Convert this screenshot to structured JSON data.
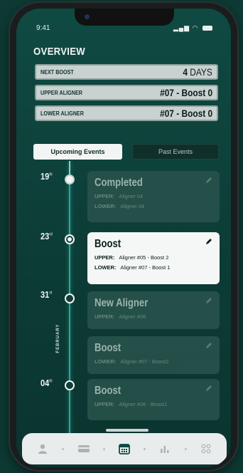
{
  "status": {
    "time": "9:41"
  },
  "overview": {
    "title": "OVERVIEW",
    "next_boost": {
      "label": "NEXT BOOST",
      "number": "4",
      "unit": "DAYS"
    },
    "upper_aligner": {
      "label": "UPPER ALIGNER",
      "value": "#07 - Boost 0"
    },
    "lower_aligner": {
      "label": "LOWER ALIGNER",
      "value": "#07 - Boost 0"
    }
  },
  "tabs": {
    "upcoming": "Upcoming Events",
    "past": "Past Events"
  },
  "month_label": "FEBRUARY",
  "events": [
    {
      "day": "19",
      "suffix": "th",
      "title": "Completed",
      "lines": [
        {
          "label": "UPPER:",
          "value": "Aligner 04"
        },
        {
          "label": "LOWER:",
          "value": "Aligner 04"
        }
      ]
    },
    {
      "day": "23",
      "suffix": "rd",
      "title": "Boost",
      "lines": [
        {
          "label": "UPPER:",
          "value": "Aligner #05 - Boost 2"
        },
        {
          "label": "LOWER:",
          "value": "Aligner #07 - Boost 1"
        }
      ]
    },
    {
      "day": "31",
      "suffix": "st",
      "title": "New Aligner",
      "lines": [
        {
          "label": "UPPER:",
          "value": "Aligner #06"
        }
      ]
    },
    {
      "title": "Boost",
      "lines": [
        {
          "label": "LOWER:",
          "value": "Aligner #07 - Boost2"
        }
      ]
    },
    {
      "day": "04",
      "suffix": "th",
      "title": "Boost",
      "lines": [
        {
          "label": "UPPER:",
          "value": "Aligner #06 - Boost1"
        }
      ]
    }
  ],
  "colors": {
    "background": "#0d3a33",
    "accent": "#2aa89a",
    "card_active": "#f4f7f6",
    "card_inactive": "#27524b"
  },
  "nav": [
    "profile-icon",
    "card-icon",
    "calendar-icon",
    "bar-chart-icon",
    "grid-icon"
  ]
}
